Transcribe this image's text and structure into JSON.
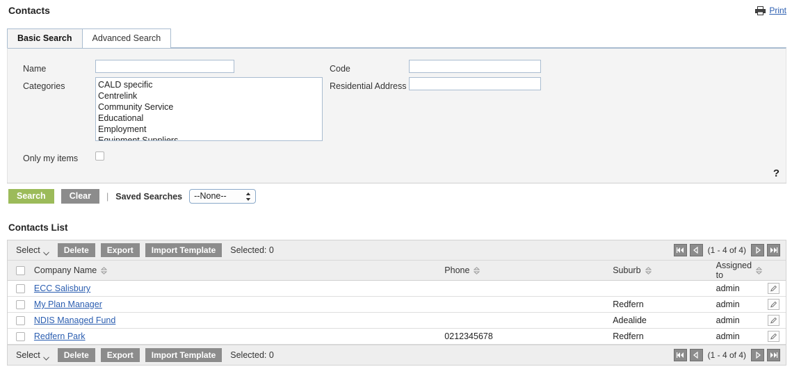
{
  "header": {
    "title": "Contacts",
    "print_label": "Print",
    "printer_icon": "printer-icon"
  },
  "tabs": [
    {
      "label": "Basic Search",
      "active": true
    },
    {
      "label": "Advanced Search",
      "active": false
    }
  ],
  "search_form": {
    "name_label": "Name",
    "name_value": "",
    "categories_label": "Categories",
    "categories_options": [
      "CALD specific",
      "Centrelink",
      "Community Service",
      "Educational",
      "Employment",
      "Equipment Suppliers"
    ],
    "only_my_items_label": "Only my items",
    "only_my_items_checked": false,
    "code_label": "Code",
    "code_value": "",
    "residential_address_label": "Residential Address",
    "residential_address_value": "",
    "help_icon": "?"
  },
  "action_bar": {
    "search_label": "Search",
    "clear_label": "Clear",
    "separator": "|",
    "saved_searches_label": "Saved Searches",
    "saved_searches_value": "--None--"
  },
  "list": {
    "title": "Contacts List",
    "toolbar": {
      "select_label": "Select",
      "delete_label": "Delete",
      "export_label": "Export",
      "import_template_label": "Import Template",
      "selected_label": "Selected: 0"
    },
    "pager": {
      "text": "(1 - 4 of 4)",
      "first_title": "First",
      "prev_title": "Previous",
      "next_title": "Next",
      "last_title": "Last"
    },
    "columns": [
      {
        "label": "Company Name"
      },
      {
        "label": "Phone"
      },
      {
        "label": "Suburb"
      },
      {
        "label": "Assigned to"
      }
    ],
    "rows": [
      {
        "company": "ECC Salisbury",
        "phone": "",
        "suburb": "",
        "assigned": "admin"
      },
      {
        "company": "My Plan Manager",
        "phone": "",
        "suburb": "Redfern",
        "assigned": "admin"
      },
      {
        "company": "NDIS Managed Fund",
        "phone": "",
        "suburb": "Adealide",
        "assigned": "admin"
      },
      {
        "company": "Redfern Park",
        "phone": "0212345678",
        "suburb": "Redfern",
        "assigned": "admin"
      }
    ]
  },
  "colors": {
    "accent_green": "#9cbb5a",
    "button_grey": "#8c8c8c",
    "link_blue": "#2a5db0",
    "panel_bg": "#f4f4f4",
    "panel_border": "#a9bcd0"
  }
}
